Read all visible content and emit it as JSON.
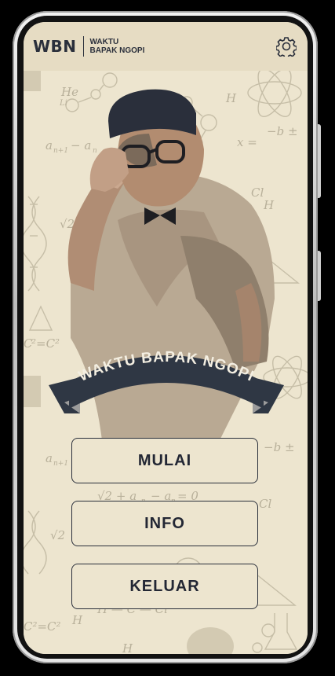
{
  "header": {
    "logo": "WBN",
    "subtitle_line1": "WAKTU",
    "subtitle_line2": "BAPAK NGOPI",
    "settings_icon": "gear-icon"
  },
  "banner": {
    "title": "WAKTU BAPAK NGOPI"
  },
  "menu": {
    "start_label": "MULAI",
    "info_label": "INFO",
    "exit_label": "KELUAR"
  },
  "colors": {
    "background": "#ede5cf",
    "header": "#e6dcc3",
    "ink": "#2a2f3b",
    "banner": "#2f3744",
    "doodle": "#b8b09a"
  }
}
